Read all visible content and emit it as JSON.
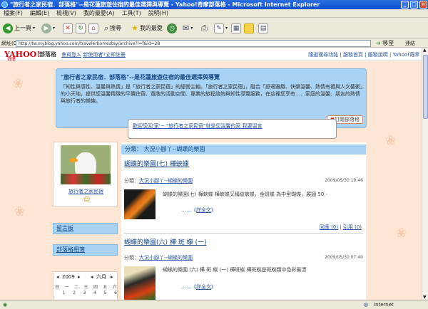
{
  "window": {
    "title": "\"旅行者之家民宿．部落格\"--是花蓮旅遊住宿的最佳選擇與導覽 - Yahoo!奇摩部落格 - Microsoft Internet Explorer"
  },
  "menu": [
    "檔案(F)",
    "編輯(E)",
    "檢視(V)",
    "我的最愛(A)",
    "工具(T)",
    "說明(H)"
  ],
  "toolbar": {
    "back": "上一頁",
    "search": "搜尋",
    "favorites": "我的最愛"
  },
  "address": {
    "label": "網址(D)",
    "url": "http://tw.myblog.yahoo.com/travelerhomestay/archive?l=f&id=28",
    "go": "移至",
    "links": "連結"
  },
  "ynav": {
    "logo": "YAHOO!",
    "logo_sub": "奇摩",
    "brand": "部落格",
    "links": [
      "會員登入",
      "新使用者?立即註冊"
    ],
    "right": [
      "隨選搜尋功能",
      "服務首頁",
      "服務說明",
      "Yahoo!奇摩"
    ]
  },
  "banner": {
    "title": "\"旅行者之家民宿．部落格\"--是花蓮旅遊住宿的最佳選擇與導覽",
    "desc": "「知性與感性、溫馨與熱情」是「旅行者之家民宿」的經營主軸。「旅行者之家民宿」，融合「舒適雅緻、快樂溫馨、熱情有禮與人文藝術」的小天地，提供您溫馨精緻的平價住宿、寬敞的活動空間、專業的旅程諮詢與知性導覽服務，在這裡您享有……家庭的溫馨、朋友的熱情與旅行者的樂趣。",
    "subscribe": "訂閱部落格"
  },
  "welcome": {
    "text": "歡迎您回'家'~ \"旅行者之家民宿\"就是您溫馨的家 我要留言"
  },
  "sidebar": {
    "name": "旅行者之家民宿",
    "guestbook": "留言板",
    "blog_links": "部落格相簿",
    "cal_year": "2009",
    "cal_month": "六月",
    "cal_days": [
      "日",
      "一",
      "二",
      "三",
      "四",
      "五",
      "六"
    ],
    "cal_nums": [
      "1",
      "2",
      "3",
      "4",
      "5",
      "6"
    ]
  },
  "category": {
    "head": "分類：  大況小腳丫--蝴蝶的樂園"
  },
  "posts": [
    {
      "title": "蝴蝶的樂園(七) 樺蛺蝶",
      "cat_label": "分類：",
      "cat": "大況小腳丫--蝴蝶的樂園",
      "date": "2009/05/30 10:46",
      "text": "蝴蝶的樂園(七) 樺蛺蝶 樺蛺蝶又稱紋蛺蝶，金斑蝶 為中型蝴蝶，展翅 50 -",
      "more": "詳全文",
      "comments": "回應 (0)",
      "trackback": "引用 (0)"
    },
    {
      "title": "蝴蝶的樂園(六) 樺 斑 蝶 (一)",
      "cat_label": "分類：",
      "cat": "大況小腳丫--蝴蝶的樂園",
      "date": "2009/05/30 07:40",
      "text": "蝴蝶的樂園 (六) 樺 斑 蝶 (一) 樺斑蝶  樺斑蝶是斑蝶類中色彩最漂",
      "more": "詳全文"
    }
  ],
  "status": {
    "zone": "Internet"
  }
}
